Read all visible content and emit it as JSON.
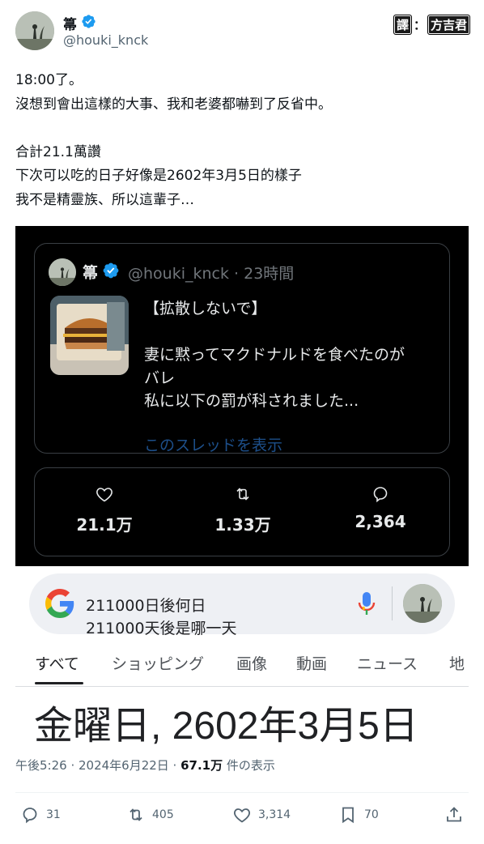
{
  "author": {
    "display_name": "箒",
    "handle": "@houki_knck",
    "verified": true
  },
  "translator_badge": {
    "label1": "譯",
    "separator": "：",
    "label2": "方吉君"
  },
  "tweet": {
    "lines": [
      "18:00了。",
      "沒想到會出這樣的大事、我和老婆都嚇到了反省中。",
      "",
      "合計21.1萬讚",
      "下次可以吃的日子好像是2602年3月5日的樣子",
      "我不是精靈族、所以這輩子…"
    ]
  },
  "quoted_post": {
    "display_name": "箒",
    "handle_time": "@houki_knck · 23時間",
    "lines": [
      "【拡散しないで】",
      "",
      "妻に黙ってマクドナルドを食べたのが",
      "バレ",
      "私に以下の罰が科されました..."
    ],
    "show_thread": "このスレッドを表示",
    "stats": {
      "likes": "21.1万",
      "reposts": "1.33万",
      "replies": "2,364"
    }
  },
  "google": {
    "query_line1": "211000日後何日",
    "query_line2": "211000天後是哪一天",
    "tabs": [
      "すべて",
      "ショッピング",
      "画像",
      "動画",
      "ニュース",
      "地"
    ],
    "active_tab": "すべて",
    "result": "金曜日, 2602年3月5日"
  },
  "meta": {
    "time_date": "午後5:26 · 2024年6月22日 · ",
    "views": "67.1万",
    "views_suffix": " 件の表示"
  },
  "actions": {
    "replies": "31",
    "reposts": "405",
    "likes": "3,314",
    "bookmarks": "70"
  },
  "colors": {
    "verified_blue": "#1d9bf0",
    "dark_bg": "#000000",
    "muted_text": "#536471"
  }
}
